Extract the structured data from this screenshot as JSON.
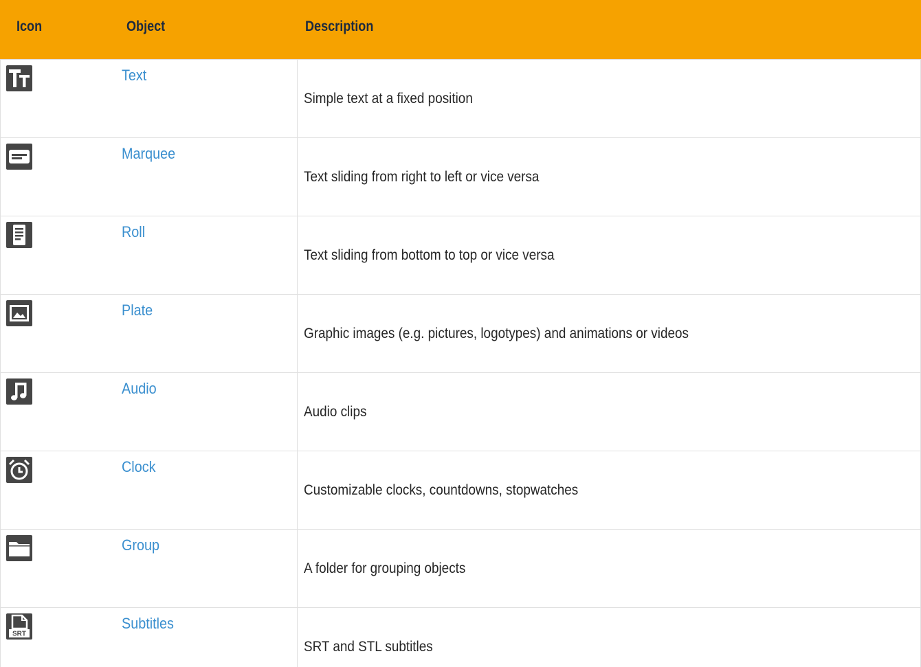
{
  "header": {
    "icon": "Icon",
    "object": "Object",
    "description": "Description",
    "background": "#f6a200"
  },
  "rows": [
    {
      "icon": "text-tt-icon",
      "object": "Text",
      "description": "Simple text at a fixed position"
    },
    {
      "icon": "marquee-icon",
      "object": "Marquee",
      "description": "Text sliding from right to left or vice versa"
    },
    {
      "icon": "roll-document-icon",
      "object": "Roll",
      "description": "Text sliding from bottom to top or vice versa"
    },
    {
      "icon": "plate-image-icon",
      "object": "Plate",
      "description": "Graphic images (e.g. pictures, logotypes) and animations or videos"
    },
    {
      "icon": "audio-music-note-icon",
      "object": "Audio",
      "description": "Audio clips"
    },
    {
      "icon": "clock-alarm-icon",
      "object": "Clock",
      "description": "Customizable clocks, countdowns, stopwatches"
    },
    {
      "icon": "group-folder-icon",
      "object": "Group",
      "description": "A folder for grouping objects"
    },
    {
      "icon": "subtitles-srt-file-icon",
      "object": "Subtitles",
      "description": "SRT and STL subtitles",
      "icon_text": "SRT"
    }
  ],
  "colors": {
    "link": "#3a8fcf",
    "icon_bg": "#454545",
    "grid": "#e0e0e0"
  }
}
